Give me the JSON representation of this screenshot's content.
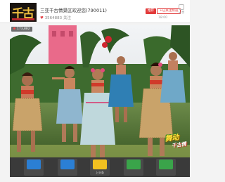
{
  "header": {
    "title": "三亚千古情景区欢迎您(790011)",
    "followers": "3564883",
    "fans_label": "关注",
    "fans_tab": "",
    "recommend_button": "推荐",
    "subscribe_button": "+已关注频道",
    "time_label": "18:00",
    "share_label": "分享"
  },
  "video": {
    "badge": "173,882",
    "watermark_line1": "舞动",
    "watermark_line2": "千古情"
  },
  "gifts": [
    {
      "label": "",
      "color": "#2b7fd4"
    },
    {
      "label": "",
      "color": "#2b7fd4"
    },
    {
      "label": "上头条",
      "color": "#f2c020"
    },
    {
      "label": "",
      "color": "#3aa44a"
    },
    {
      "label": "",
      "color": "#3aa44a"
    }
  ],
  "colors": {
    "accent": "#e23a3a",
    "gift_bar": "#3a3a3a"
  }
}
